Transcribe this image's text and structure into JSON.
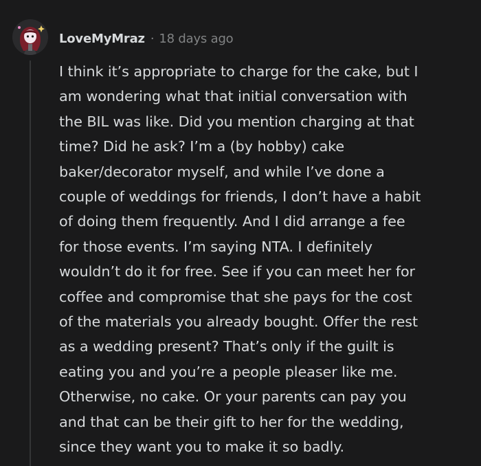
{
  "comment": {
    "author": "LoveMyMraz",
    "separator": "·",
    "age": "18 days ago",
    "avatar_icon": "snoo-avatar-icon",
    "body_lines": [
      "I think it’s appropriate to charge for the cake, but I",
      "am wondering what that initial conversation with",
      "the BIL was like. Did you mention charging at that",
      "time? Did he ask? I’m a (by hobby) cake",
      "baker/decorator myself, and while I’ve done a",
      "couple of weddings for friends, I don’t have a habit",
      "of doing them frequently. And I did arrange a fee",
      "for those events. I’m saying NTA. I definitely",
      "wouldn’t do it for free. See if you can meet her for",
      "coffee and compromise that she pays for the cost",
      "of the materials you already bought. Offer the rest",
      "as a wedding present? That’s only if the guilt is",
      "eating you and you’re a people pleaser like me.",
      "Otherwise, no cake. Or your parents can pay you",
      "and that can be their gift to her for the wedding,",
      "since they want you to make it so badly."
    ]
  },
  "colors": {
    "background": "#1a1a1b",
    "text": "#d7dadc",
    "meta": "#818384",
    "thread_line": "#343536",
    "avatar_hair": "#7a1e2a"
  }
}
